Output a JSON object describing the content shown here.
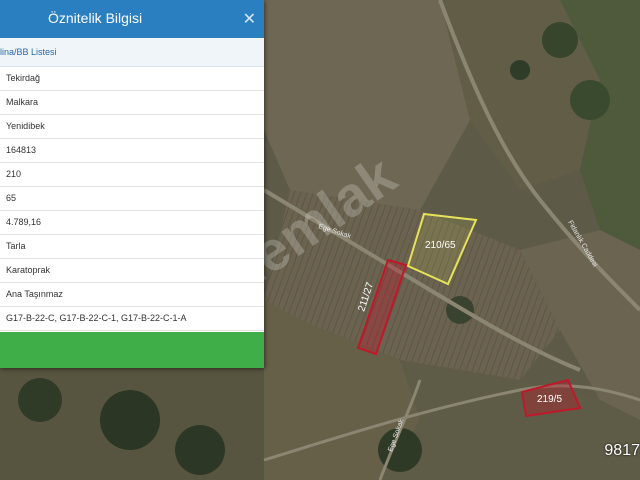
{
  "panel": {
    "title": "Öznitelik Bilgisi",
    "close_icon": "close-icon",
    "subheader": "lina/BB Listesi",
    "rows": [
      "Tekirdağ",
      "Malkara",
      "Yenidibek",
      "164813",
      "210",
      "65",
      "4.789,16",
      "Tarla",
      "Karatoprak",
      "Ana Taşınmaz",
      "G17-B-22-C, G17-B-22-C-1, G17-B-22-C-1-A"
    ]
  },
  "map": {
    "parcels": [
      {
        "label": "210/65",
        "color": "#e6e35a"
      },
      {
        "label": "211/27",
        "color": "#c0182a"
      },
      {
        "label": "219/5",
        "color": "#c0182a"
      }
    ],
    "roads": [
      {
        "label": "Ege Sokak"
      },
      {
        "label": "Fidanlık Caddesi"
      },
      {
        "label": "Ege Sokak"
      }
    ],
    "watermark": "hepsiemlak",
    "corner_text": "9817"
  }
}
